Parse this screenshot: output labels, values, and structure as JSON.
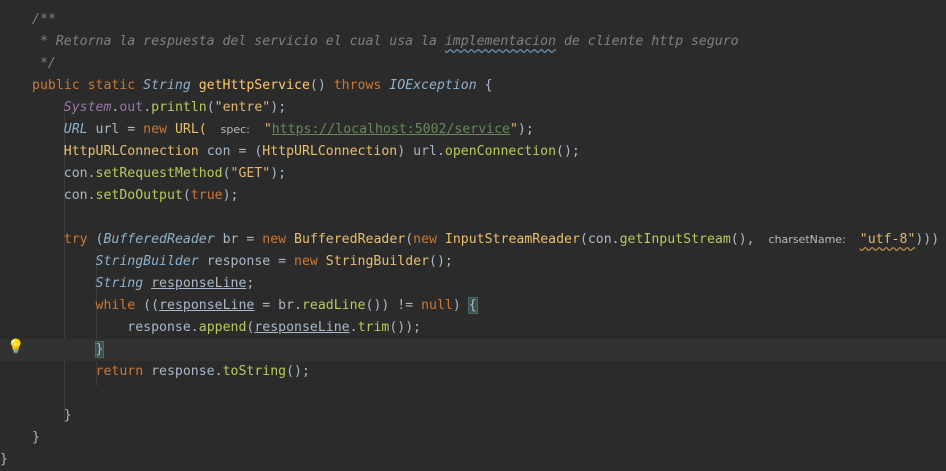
{
  "editor": {
    "lines": [
      {
        "segments": [
          {
            "t": "/**",
            "c": "cmt"
          }
        ]
      },
      {
        "segments": [
          {
            "t": " * Retorna la respuesta del servicio el cual usa la ",
            "c": "cmt"
          },
          {
            "t": "implementacion",
            "c": "cmt wavy"
          },
          {
            "t": " de cliente http seguro",
            "c": "cmt"
          }
        ]
      },
      {
        "segments": [
          {
            "t": " */",
            "c": "cmt"
          }
        ]
      },
      {
        "segments": [
          {
            "t": "public static ",
            "c": "kw"
          },
          {
            "t": "String ",
            "c": "typi"
          },
          {
            "t": "getHttpService",
            "c": "fn"
          },
          {
            "t": "() ",
            "c": ""
          },
          {
            "t": "throws ",
            "c": "kw"
          },
          {
            "t": "IOException",
            "c": "typi"
          },
          {
            "t": " {",
            "c": ""
          }
        ]
      },
      {
        "segments": [
          {
            "t": "    ",
            "c": ""
          },
          {
            "t": "System",
            "c": "typ"
          },
          {
            "t": ".",
            "c": ""
          },
          {
            "t": "out",
            "c": "fld"
          },
          {
            "t": ".",
            "c": ""
          },
          {
            "t": "println",
            "c": "mcall"
          },
          {
            "t": "(",
            "c": ""
          },
          {
            "t": "\"entre\"",
            "c": "str2"
          },
          {
            "t": ");",
            "c": ""
          }
        ]
      },
      {
        "segments": [
          {
            "t": "    ",
            "c": ""
          },
          {
            "t": "URL ",
            "c": "typi"
          },
          {
            "t": "url = ",
            "c": ""
          },
          {
            "t": "new ",
            "c": "kw"
          },
          {
            "t": "URL( ",
            "c": "cls2"
          },
          {
            "t": "spec:",
            "c": "hint"
          },
          {
            "t": " \"",
            "c": "str2"
          },
          {
            "t": "https://localhost:5002/service",
            "c": "str u"
          },
          {
            "t": "\"",
            "c": "str2"
          },
          {
            "t": ");",
            "c": ""
          }
        ]
      },
      {
        "segments": [
          {
            "t": "    ",
            "c": ""
          },
          {
            "t": "HttpURLConnection ",
            "c": "cls2"
          },
          {
            "t": "con = (",
            "c": ""
          },
          {
            "t": "HttpURLConnection",
            "c": "cls2"
          },
          {
            "t": ") url.",
            "c": ""
          },
          {
            "t": "openConnection",
            "c": "mcall"
          },
          {
            "t": "();",
            "c": ""
          }
        ]
      },
      {
        "segments": [
          {
            "t": "    ",
            "c": ""
          },
          {
            "t": "con.",
            "c": ""
          },
          {
            "t": "setRequestMethod",
            "c": "mcall"
          },
          {
            "t": "(",
            "c": ""
          },
          {
            "t": "\"GET\"",
            "c": "str2"
          },
          {
            "t": ");",
            "c": ""
          }
        ]
      },
      {
        "segments": [
          {
            "t": "    ",
            "c": ""
          },
          {
            "t": "con.",
            "c": ""
          },
          {
            "t": "setDoOutput",
            "c": "mcall"
          },
          {
            "t": "(",
            "c": ""
          },
          {
            "t": "true",
            "c": "kw"
          },
          {
            "t": ");",
            "c": ""
          }
        ]
      },
      {
        "segments": [
          {
            "t": "",
            "c": ""
          }
        ]
      },
      {
        "segments": [
          {
            "t": "    ",
            "c": ""
          },
          {
            "t": "try ",
            "c": "kw"
          },
          {
            "t": "(",
            "c": ""
          },
          {
            "t": "BufferedReader ",
            "c": "typi"
          },
          {
            "t": "br = ",
            "c": ""
          },
          {
            "t": "new ",
            "c": "kw"
          },
          {
            "t": "BufferedReader",
            "c": "cls2"
          },
          {
            "t": "(",
            "c": ""
          },
          {
            "t": "new ",
            "c": "kw"
          },
          {
            "t": "InputStreamReader",
            "c": "cls2"
          },
          {
            "t": "(con.",
            "c": ""
          },
          {
            "t": "getInputStream",
            "c": "mcall"
          },
          {
            "t": "(), ",
            "c": ""
          },
          {
            "t": "charsetName:",
            "c": "hint"
          },
          {
            "t": " ",
            "c": ""
          },
          {
            "t": "\"utf-8\"",
            "c": "str2 wavy2"
          },
          {
            "t": "))) {",
            "c": ""
          }
        ]
      },
      {
        "segments": [
          {
            "t": "        ",
            "c": ""
          },
          {
            "t": "StringBuilder ",
            "c": "typi"
          },
          {
            "t": "response = ",
            "c": ""
          },
          {
            "t": "new ",
            "c": "kw"
          },
          {
            "t": "StringBuilder",
            "c": "cls2"
          },
          {
            "t": "();",
            "c": ""
          }
        ]
      },
      {
        "segments": [
          {
            "t": "        ",
            "c": ""
          },
          {
            "t": "String ",
            "c": "typi"
          },
          {
            "t": "responseLine",
            "c": "u"
          },
          {
            "t": ";",
            "c": ""
          }
        ]
      },
      {
        "segments": [
          {
            "t": "        ",
            "c": ""
          },
          {
            "t": "while ",
            "c": "kw"
          },
          {
            "t": "((",
            "c": ""
          },
          {
            "t": "responseLine",
            "c": "u"
          },
          {
            "t": " = br.",
            "c": ""
          },
          {
            "t": "readLine",
            "c": "mcall"
          },
          {
            "t": "()) != ",
            "c": ""
          },
          {
            "t": "null",
            "c": "kw"
          },
          {
            "t": ") ",
            "c": ""
          },
          {
            "t": "{",
            "c": "brace-hl"
          }
        ]
      },
      {
        "segments": [
          {
            "t": "            ",
            "c": ""
          },
          {
            "t": "response.",
            "c": ""
          },
          {
            "t": "append",
            "c": "mcall"
          },
          {
            "t": "(",
            "c": ""
          },
          {
            "t": "responseLine",
            "c": "u"
          },
          {
            "t": ".",
            "c": ""
          },
          {
            "t": "trim",
            "c": "mcall"
          },
          {
            "t": "());",
            "c": ""
          }
        ]
      },
      {
        "segments": [
          {
            "t": "        ",
            "c": ""
          },
          {
            "t": "}",
            "c": "brace-hl"
          }
        ]
      },
      {
        "segments": [
          {
            "t": "        ",
            "c": ""
          },
          {
            "t": "return ",
            "c": "kw"
          },
          {
            "t": "response.",
            "c": ""
          },
          {
            "t": "toString",
            "c": "mcall"
          },
          {
            "t": "();",
            "c": ""
          }
        ]
      },
      {
        "segments": [
          {
            "t": "",
            "c": ""
          }
        ]
      },
      {
        "segments": [
          {
            "t": "    }",
            "c": ""
          }
        ]
      },
      {
        "segments": [
          {
            "t": "}",
            "c": ""
          }
        ]
      },
      {
        "segments": [
          {
            "t": "}",
            "c": ""
          }
        ]
      }
    ],
    "current_line": 15,
    "intention_icon": "lightbulb-icon"
  }
}
